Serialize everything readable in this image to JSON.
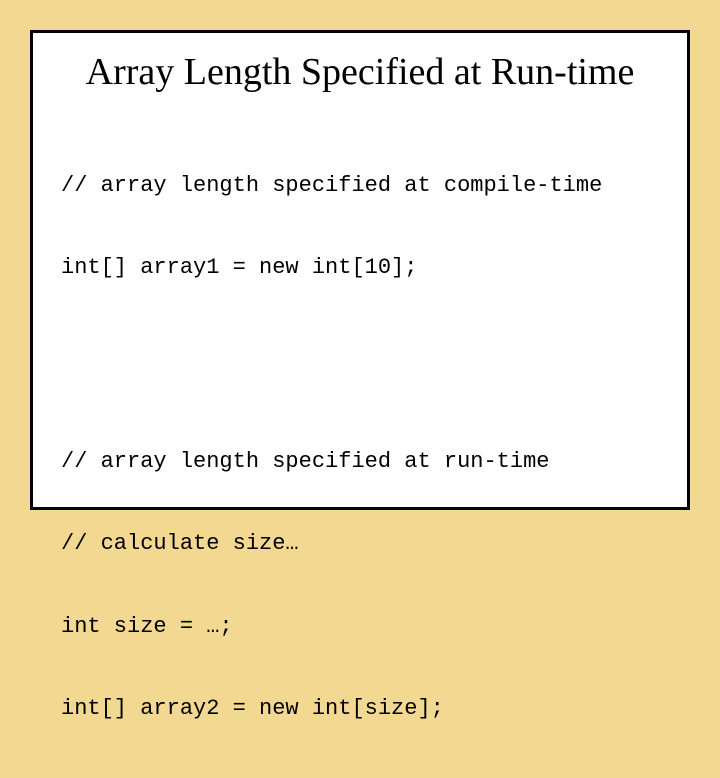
{
  "slide": {
    "title": "Array Length Specified at Run-time",
    "code": {
      "block1": {
        "l1": "// array length specified at compile-time",
        "l2": "int[] array1 = new int[10];"
      },
      "block2": {
        "l1": "// array length specified at run-time",
        "l2": "// calculate size…",
        "l3": "int size = …;",
        "l4": "int[] array2 = new int[size];"
      }
    }
  }
}
